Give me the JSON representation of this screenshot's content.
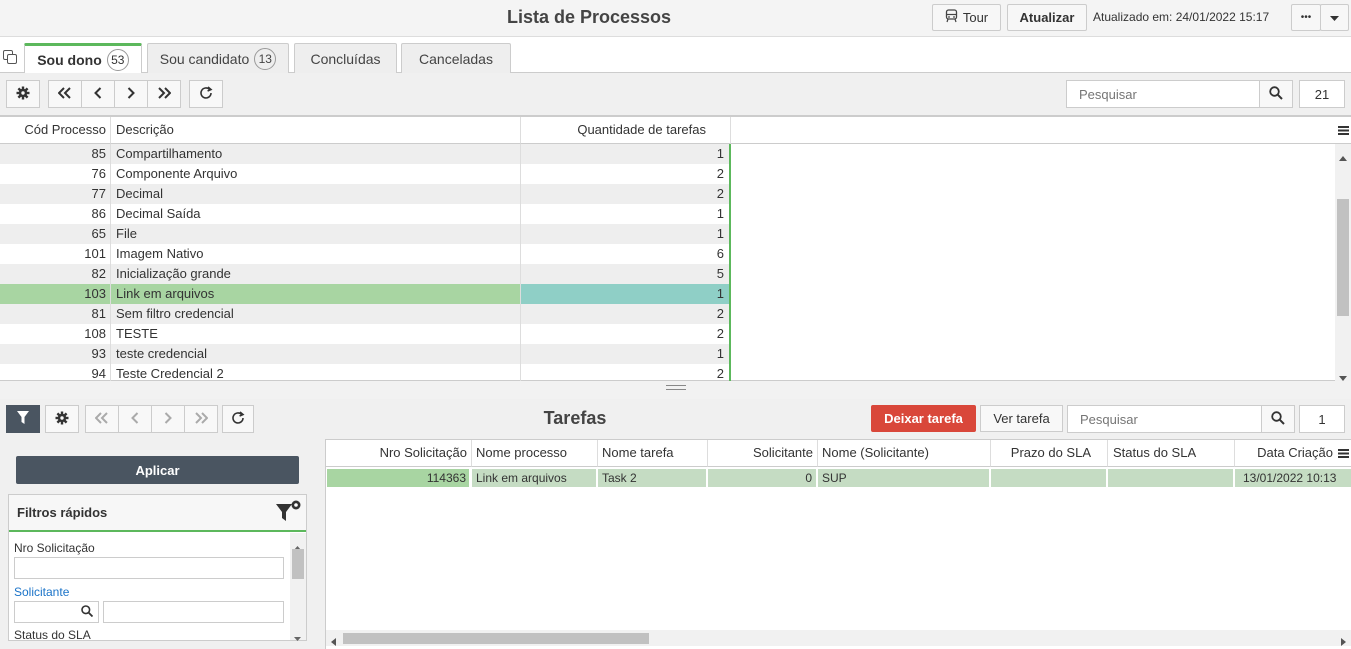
{
  "header": {
    "title": "Lista de Processos",
    "tour_label": "Tour",
    "refresh_label": "Atualizar",
    "updated_text": "Atualizado em: 24/01/2022 15:17",
    "more_label": "•••"
  },
  "tabs": [
    {
      "label": "Sou dono",
      "count": "53"
    },
    {
      "label": "Sou candidato",
      "count": "13"
    },
    {
      "label": "Concluídas"
    },
    {
      "label": "Canceladas"
    }
  ],
  "process_toolbar": {
    "search_placeholder": "Pesquisar",
    "page_size": "21"
  },
  "process_table": {
    "columns": [
      "Cód Processo",
      "Descrição",
      "Quantidade de tarefas"
    ],
    "rows": [
      [
        "85",
        "Compartilhamento",
        "1"
      ],
      [
        "76",
        "Componente Arquivo",
        "2"
      ],
      [
        "77",
        "Decimal",
        "2"
      ],
      [
        "86",
        "Decimal Saída",
        "1"
      ],
      [
        "65",
        "File",
        "1"
      ],
      [
        "101",
        "Imagem Nativo",
        "6"
      ],
      [
        "82",
        "Inicialização grande",
        "5"
      ],
      [
        "103",
        "Link em arquivos",
        "1"
      ],
      [
        "81",
        "Sem filtro credencial",
        "2"
      ],
      [
        "108",
        "TESTE",
        "2"
      ],
      [
        "93",
        "teste credencial",
        "1"
      ],
      [
        "94",
        "Teste Credencial 2",
        "2"
      ]
    ],
    "selected_row": 7
  },
  "tasks": {
    "title": "Tarefas",
    "leave_label": "Deixar tarefa",
    "view_label": "Ver tarefa",
    "search_placeholder": "Pesquisar",
    "page_size": "1",
    "apply_label": "Aplicar",
    "quick_filters": {
      "title": "Filtros rápidos",
      "nro_label": "Nro Solicitação",
      "solicitante_label": "Solicitante",
      "status_label": "Status do SLA"
    },
    "columns": [
      "Nro Solicitação",
      "Nome processo",
      "Nome tarefa",
      "Solicitante",
      "Nome (Solicitante)",
      "Prazo do SLA",
      "Status do SLA",
      "Data Criação"
    ],
    "rows": [
      [
        "114363",
        "Link em arquivos",
        "Task 2",
        "0",
        "SUP",
        "",
        "",
        "13/01/2022 10:13"
      ]
    ]
  },
  "colors": {
    "accent_green": "#5cb85c",
    "danger": "#d9473a",
    "dark_button": "#4a5561",
    "selected_row": "#a8d5a2"
  }
}
